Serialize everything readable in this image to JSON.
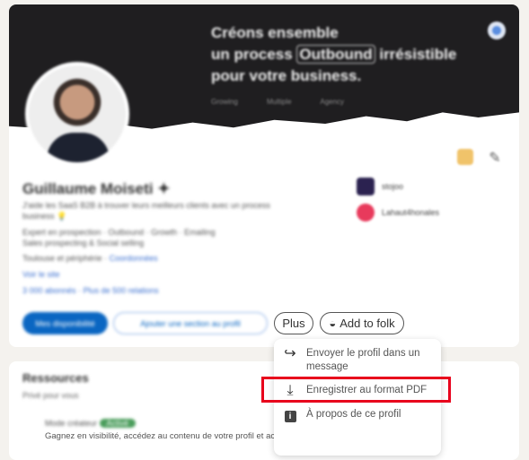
{
  "banner": {
    "line1": "Créons ensemble",
    "line2a": "un process ",
    "highlight": "Outbound",
    "line2b": " irrésistible",
    "line3": "pour votre business.",
    "sub": "Growing Multiple Agency"
  },
  "profile": {
    "name": "Guillaume Moiseti ✦",
    "headline": "J'aide les SaaS B2B à trouver leurs meilleurs clients avec un process",
    "headline2": "business 💡",
    "skills": "Expert en prospection · Outbound · Growth · Emailing",
    "skills2": "Sales prospecting & Social selling",
    "location": "Toulouse et périphérie ·",
    "contact": "Coordonnées",
    "website": "Voir le site",
    "followers": "3 000 abonnés",
    "connections": "Plus de 500 relations"
  },
  "orgs": [
    {
      "name": "stojoo",
      "color": "#2b2250"
    },
    {
      "name": "Lahaut4honales",
      "color": "#e83a5c"
    }
  ],
  "actions": {
    "primary": "Mes disponibilité",
    "secondary": "Ajouter une section au profil",
    "more": "Plus",
    "folk": "Add to folk"
  },
  "menu": {
    "items": [
      {
        "icon": "share-arrow-icon",
        "label": "Envoyer le profil dans un message"
      },
      {
        "icon": "download-icon",
        "label": "Enregistrer au format PDF"
      },
      {
        "icon": "info-icon",
        "label": "À propos de ce profil"
      }
    ]
  },
  "resources": {
    "title": "Ressources",
    "private": "Privé pour vous",
    "mode": "Mode créateur",
    "badge": "Activé",
    "desc": "Gagnez en visibilité, accédez au contenu de votre profil et accédez aux outils de création"
  },
  "colors": {
    "accent": "#0a66c2",
    "highlight": "#e8001c"
  }
}
